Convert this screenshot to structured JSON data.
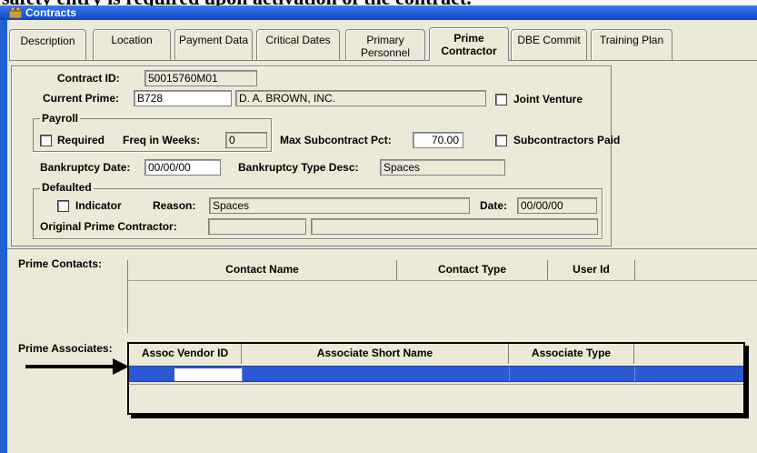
{
  "doc_heading": "safety entry is required upon activation of the contract.",
  "window": {
    "title": "Contracts",
    "icon": "contracts-app-icon"
  },
  "tabs": [
    {
      "label_line1": "Description",
      "label_line2": ""
    },
    {
      "label_line1": "Location",
      "label_line2": ""
    },
    {
      "label_line1": "Payment Data",
      "label_line2": ""
    },
    {
      "label_line1": "Critical Dates",
      "label_line2": ""
    },
    {
      "label_line1": "Primary",
      "label_line2": "Personnel"
    },
    {
      "label_line1": "Prime",
      "label_line2": "Contractor"
    },
    {
      "label_line1": "DBE Commit",
      "label_line2": ""
    },
    {
      "label_line1": "Training Plan",
      "label_line2": ""
    }
  ],
  "active_tab": "Prime Contractor",
  "form": {
    "contract_id_label": "Contract ID:",
    "contract_id": "50015760M01",
    "current_prime_label": "Current Prime:",
    "current_prime_code": "B728",
    "current_prime_name": "D. A. BROWN, INC.",
    "joint_venture_label": "Joint Venture",
    "payroll": {
      "legend": "Payroll",
      "required_label": "Required",
      "freq_label": "Freq in Weeks:",
      "freq_value": "0"
    },
    "max_subcontract_label": "Max Subcontract Pct:",
    "max_subcontract_value": "70.00",
    "subcontractors_paid_label": "Subcontractors Paid",
    "bankruptcy_date_label": "Bankruptcy Date:",
    "bankruptcy_date": "00/00/00",
    "bankruptcy_type_label": "Bankruptcy Type Desc:",
    "bankruptcy_type": "Spaces",
    "defaulted": {
      "legend": "Defaulted",
      "indicator_label": "Indicator",
      "reason_label": "Reason:",
      "reason_value": "Spaces",
      "date_label": "Date:",
      "date_value": "00/00/00",
      "original_prime_label": "Original Prime Contractor:",
      "original_prime_code": "",
      "original_prime_name": ""
    }
  },
  "prime_contacts": {
    "label": "Prime Contacts:",
    "columns": [
      "Contact Name",
      "Contact Type",
      "User Id"
    ],
    "rows": []
  },
  "prime_associates": {
    "label": "Prime Associates:",
    "columns": [
      "Assoc Vendor ID",
      "Associate Short Name",
      "Associate Type"
    ],
    "rows": [
      {
        "vendor_id": "",
        "short_name": "",
        "type": "",
        "selected": true
      }
    ]
  },
  "colors": {
    "title_bar": "#1c5ad6",
    "selection": "#2c58d4",
    "window_bg": "#ece9d8"
  }
}
